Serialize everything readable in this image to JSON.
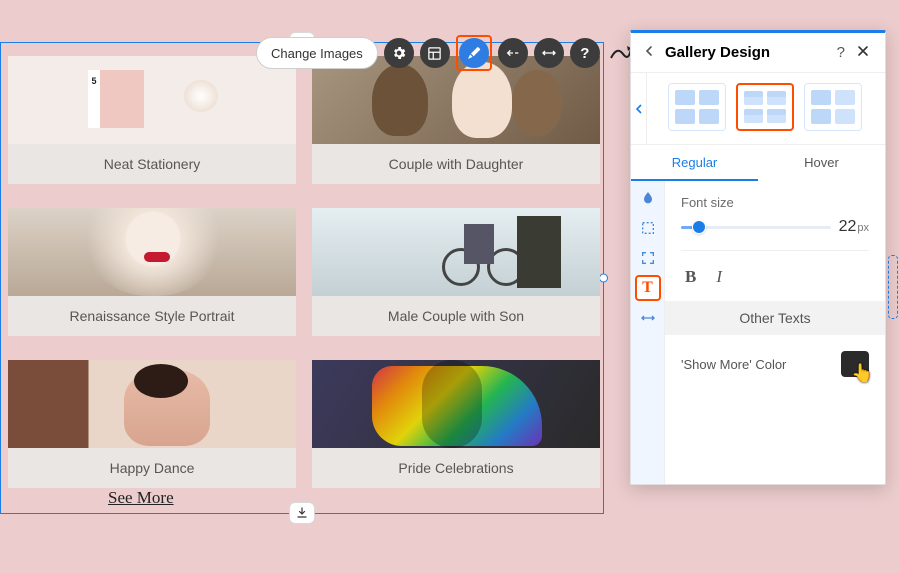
{
  "toolbar": {
    "change_images": "Change Images"
  },
  "gallery": {
    "items": [
      {
        "caption": "Neat Stationery"
      },
      {
        "caption": "Couple with Daughter"
      },
      {
        "caption": "Renaissance Style Portrait"
      },
      {
        "caption": "Male Couple with Son"
      },
      {
        "caption": "Happy Dance"
      },
      {
        "caption": "Pride Celebrations"
      }
    ],
    "see_more": "See More"
  },
  "panel": {
    "title": "Gallery Design",
    "tabs": {
      "regular": "Regular",
      "hover": "Hover"
    },
    "font_size_label": "Font size",
    "font_size_value": "22",
    "font_size_unit": "px",
    "other_texts": "Other Texts",
    "show_more_color_label": "'Show More' Color",
    "show_more_color": "#2b2b2b"
  }
}
